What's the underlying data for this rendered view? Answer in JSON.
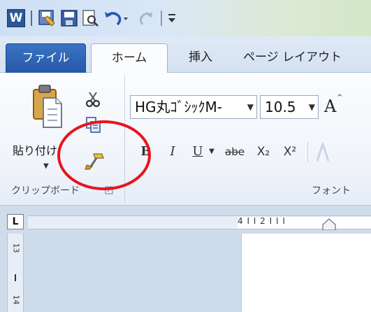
{
  "qat": {
    "word_logo": "W",
    "icons": [
      "save-as-icon",
      "save-icon",
      "print-preview-icon",
      "undo-icon",
      "redo-icon",
      "customize-icon"
    ]
  },
  "tabs": {
    "file": "ファイル",
    "home": "ホーム",
    "insert": "挿入",
    "page_layout": "ページ レイアウト"
  },
  "clipboard": {
    "paste_label": "貼り付け",
    "group_label": "クリップボード"
  },
  "font": {
    "font_name": "HG丸ｺﾞｼｯｸM-",
    "font_size": "10.5",
    "bold": "B",
    "italic": "I",
    "underline": "U",
    "strike": "abe",
    "subscript": "X₂",
    "superscript": "X²",
    "grow": "A",
    "group_label": "フォント"
  },
  "ruler": {
    "corner": "L",
    "h_marks": "4 I  I 2 I  I  I",
    "v_marks": [
      "13",
      "14"
    ]
  },
  "colors": {
    "highlight_circle": "#e8141b",
    "file_tab": "#2b5797"
  }
}
